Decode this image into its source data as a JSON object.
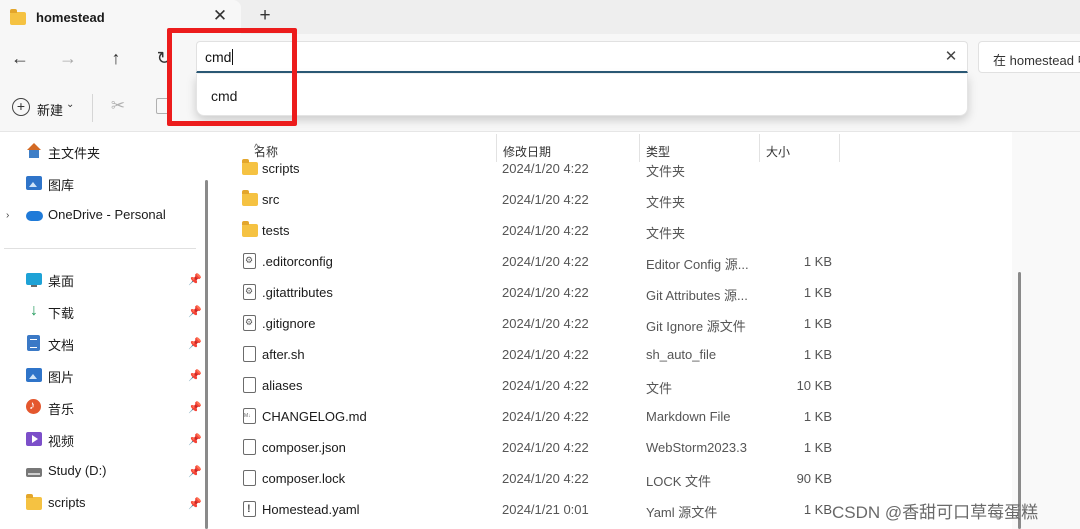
{
  "tab": {
    "title": "homestead",
    "close_glyph": "✕",
    "new_tab_glyph": "+",
    "icon": "folder-icon"
  },
  "nav": {
    "back_glyph": "←",
    "forward_glyph": "→",
    "up_glyph": "↑",
    "refresh_glyph": "↻"
  },
  "address": {
    "value": "cmd",
    "clear_glyph": "✕"
  },
  "search": {
    "placeholder": "在 homestead 中搜索"
  },
  "command_bar": {
    "new_label": "新建",
    "new_chevron": "⌄",
    "cut_glyph": "✂"
  },
  "suggestions": [
    {
      "label": "cmd"
    }
  ],
  "sidebar": {
    "items": [
      {
        "label": "主文件夹",
        "icon": "home-icon",
        "pinned": false,
        "expandable": false
      },
      {
        "label": "图库",
        "icon": "gallery-icon",
        "pinned": false,
        "expandable": false
      },
      {
        "label": "OneDrive - Personal",
        "icon": "onedrive-icon",
        "pinned": false,
        "expandable": true
      },
      {
        "label": "桌面",
        "icon": "desktop-icon",
        "pinned": true
      },
      {
        "label": "下载",
        "icon": "download-icon",
        "pinned": true
      },
      {
        "label": "文档",
        "icon": "documents-icon",
        "pinned": true
      },
      {
        "label": "图片",
        "icon": "pictures-icon",
        "pinned": true
      },
      {
        "label": "音乐",
        "icon": "music-icon",
        "pinned": true
      },
      {
        "label": "视频",
        "icon": "videos-icon",
        "pinned": true
      },
      {
        "label": "Study (D:)",
        "icon": "drive-icon",
        "pinned": true
      },
      {
        "label": "scripts",
        "icon": "folder-icon",
        "pinned": true
      }
    ],
    "pin_glyph": "📌",
    "expand_glyph": "›"
  },
  "columns": {
    "name": "名称",
    "modified": "修改日期",
    "type": "类型",
    "size": "大小"
  },
  "files": [
    {
      "name": "scripts",
      "modified": "2024/1/20 4:22",
      "type": "文件夹",
      "size": "",
      "icon": "folder-icon"
    },
    {
      "name": "src",
      "modified": "2024/1/20 4:22",
      "type": "文件夹",
      "size": "",
      "icon": "folder-icon"
    },
    {
      "name": "tests",
      "modified": "2024/1/20 4:22",
      "type": "文件夹",
      "size": "",
      "icon": "folder-icon"
    },
    {
      "name": ".editorconfig",
      "modified": "2024/1/20 4:22",
      "type": "Editor Config 源...",
      "size": "1 KB",
      "icon": "config-file-icon"
    },
    {
      "name": ".gitattributes",
      "modified": "2024/1/20 4:22",
      "type": "Git Attributes 源...",
      "size": "1 KB",
      "icon": "config-file-icon"
    },
    {
      "name": ".gitignore",
      "modified": "2024/1/20 4:22",
      "type": "Git Ignore 源文件",
      "size": "1 KB",
      "icon": "config-file-icon"
    },
    {
      "name": "after.sh",
      "modified": "2024/1/20 4:22",
      "type": "sh_auto_file",
      "size": "1 KB",
      "icon": "file-icon"
    },
    {
      "name": "aliases",
      "modified": "2024/1/20 4:22",
      "type": "文件",
      "size": "10 KB",
      "icon": "file-icon"
    },
    {
      "name": "CHANGELOG.md",
      "modified": "2024/1/20 4:22",
      "type": "Markdown File",
      "size": "1 KB",
      "icon": "markdown-file-icon"
    },
    {
      "name": "composer.json",
      "modified": "2024/1/20 4:22",
      "type": "WebStorm2023.3",
      "size": "1 KB",
      "icon": "file-icon"
    },
    {
      "name": "composer.lock",
      "modified": "2024/1/20 4:22",
      "type": "LOCK 文件",
      "size": "90 KB",
      "icon": "file-icon"
    },
    {
      "name": "Homestead.yaml",
      "modified": "2024/1/21 0:01",
      "type": "Yaml 源文件",
      "size": "1 KB",
      "icon": "yaml-file-icon"
    }
  ],
  "watermark": "CSDN @香甜可口草莓蛋糕",
  "colors": {
    "highlight": "#ec1c1c",
    "accent": "#2b5a77",
    "folder": "#f5c242"
  }
}
